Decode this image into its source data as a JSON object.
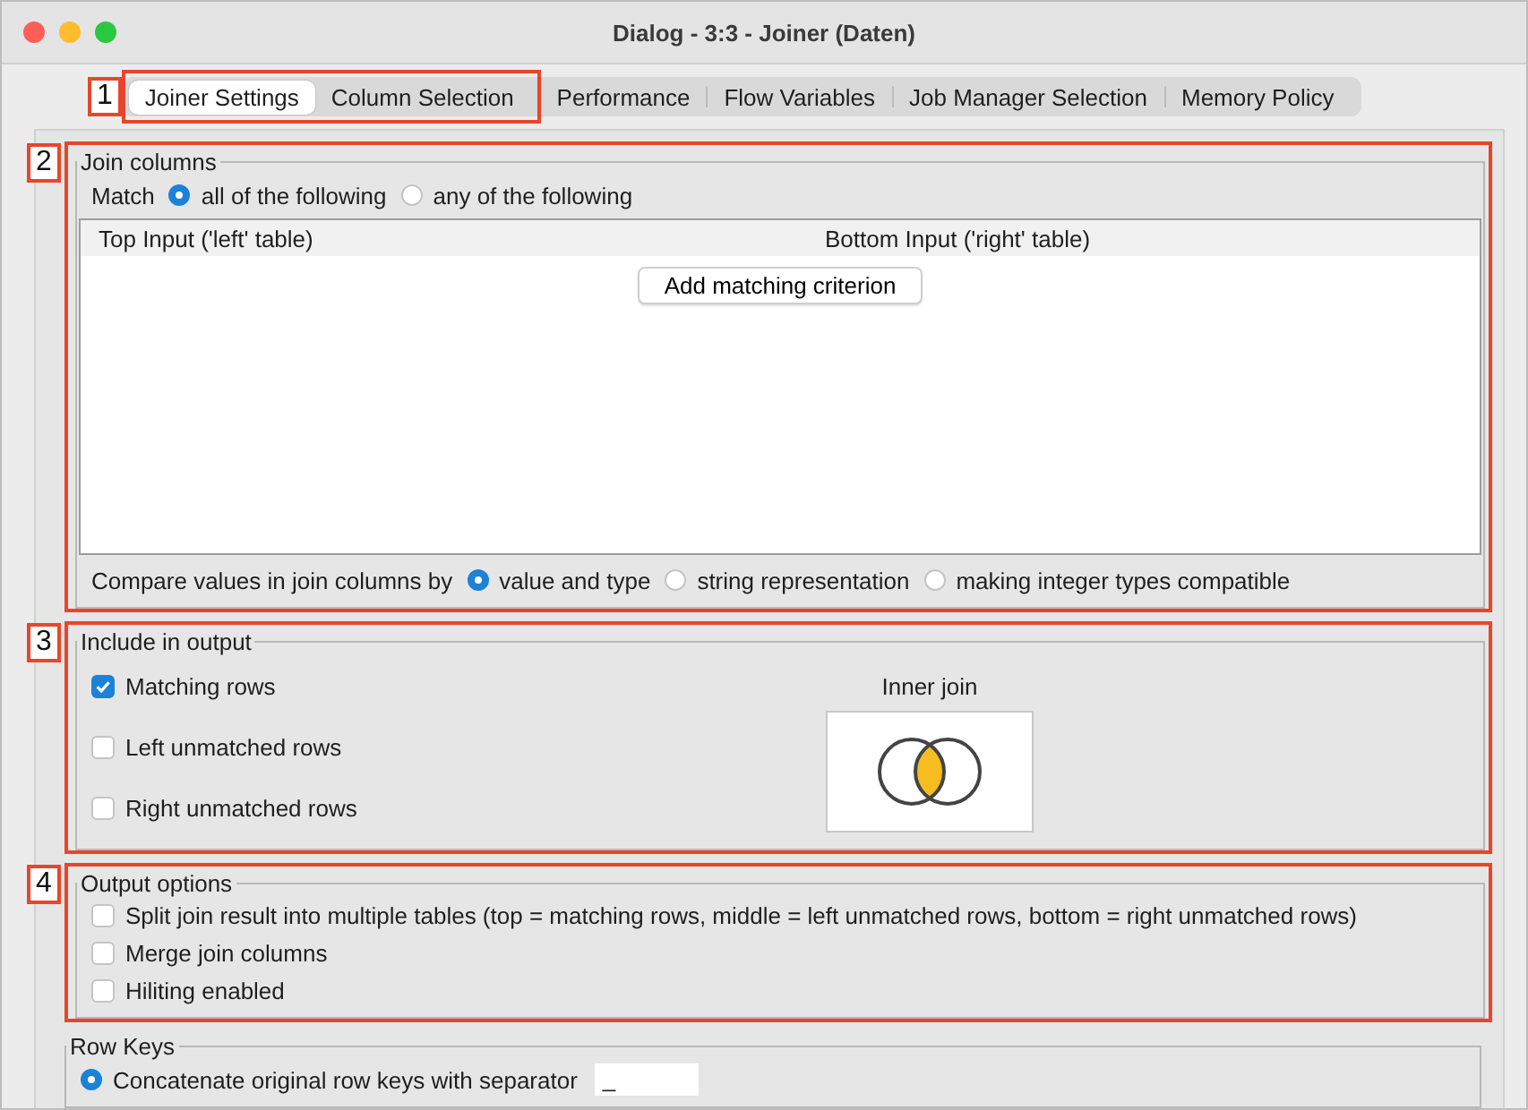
{
  "window": {
    "title": "Dialog - 3:3 - Joiner (Daten)"
  },
  "tab_marker": "1",
  "tabs": [
    {
      "label": "Joiner Settings",
      "selected": true,
      "highlighted": true
    },
    {
      "label": "Column Selection",
      "selected": false,
      "highlighted": true
    },
    {
      "label": "Performance",
      "selected": false,
      "highlighted": false
    },
    {
      "label": "Flow Variables",
      "selected": false,
      "highlighted": false
    },
    {
      "label": "Job Manager Selection",
      "selected": false,
      "highlighted": false
    },
    {
      "label": "Memory Policy",
      "selected": false,
      "highlighted": false
    }
  ],
  "join_columns": {
    "marker": "2",
    "title": "Join columns",
    "match_label": "Match",
    "match_options": [
      {
        "label": "all of the following",
        "selected": true
      },
      {
        "label": "any of the following",
        "selected": false
      }
    ],
    "table": {
      "columns": [
        "Top Input ('left' table)",
        "Bottom Input ('right' table)"
      ],
      "button": "Add matching criterion"
    },
    "compare_label": "Compare values in join columns by",
    "compare_options": [
      {
        "label": "value and type",
        "selected": true
      },
      {
        "label": "string representation",
        "selected": false
      },
      {
        "label": "making integer types compatible",
        "selected": false
      }
    ]
  },
  "include_in_output": {
    "marker": "3",
    "title": "Include in output",
    "checkboxes": [
      {
        "label": "Matching rows",
        "checked": true
      },
      {
        "label": "Left unmatched rows",
        "checked": false
      },
      {
        "label": "Right unmatched rows",
        "checked": false
      }
    ],
    "diagram_label": "Inner join"
  },
  "output_options": {
    "marker": "4",
    "title": "Output options",
    "checkboxes": [
      {
        "label": "Split join result into multiple tables (top = matching rows, middle = left unmatched rows, bottom = right unmatched rows)",
        "checked": false
      },
      {
        "label": "Merge join columns",
        "checked": false
      },
      {
        "label": "Hiliting enabled",
        "checked": false
      }
    ]
  },
  "row_keys": {
    "title": "Row Keys",
    "options": [
      {
        "label": "Concatenate original row keys with separator",
        "selected": true,
        "value": "_"
      }
    ]
  }
}
